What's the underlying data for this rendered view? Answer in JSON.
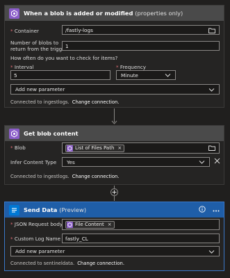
{
  "cards": [
    {
      "title": "When a blob is added or modified",
      "title_suffix": "(properties only)",
      "fields": {
        "container_label": "Container",
        "container_value": "/fastly-logs",
        "num_blobs_label_line1": "Number of blobs to",
        "num_blobs_label_line2": "return from the trigger",
        "num_blobs_value": "1",
        "check_label": "How often do you want to check for items?",
        "interval_label": "Interval",
        "interval_value": "5",
        "frequency_label": "Frequency",
        "frequency_value": "Minute",
        "add_param_label": "Add new parameter"
      },
      "connection_text": "Connected to ingestlogs.",
      "change_connection": "Change connection."
    },
    {
      "title": "Get blob content",
      "fields": {
        "blob_label": "Blob",
        "blob_token": "List of Files Path",
        "infer_label": "Infer Content Type",
        "infer_value": "Yes"
      },
      "connection_text": "Connected to ingestlogs.",
      "change_connection": "Change connection."
    },
    {
      "title": "Send Data",
      "title_suffix": "(Preview)",
      "fields": {
        "json_label": "JSON Request body",
        "json_token": "File Content",
        "log_label": "Custom Log Name",
        "log_value": "fastly_CL",
        "add_param_label": "Add new parameter"
      },
      "connection_text": "Connected to sentineldata.",
      "change_connection": "Change connection."
    }
  ],
  "colors": {
    "background": "#201f1e",
    "card": "#252423",
    "header": "#4a4a4a",
    "accent_blue": "#0078d4",
    "blob_icon": "#8a5cc9",
    "required": "#e06c75"
  }
}
